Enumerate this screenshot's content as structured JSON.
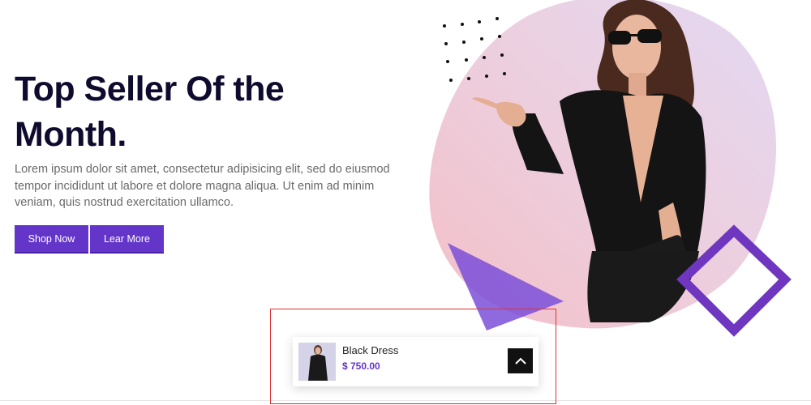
{
  "hero": {
    "title": "Top Seller Of the Month.",
    "description": "Lorem ipsum dolor sit amet, consectetur adipisicing elit, sed do eiusmod tempor incididunt ut labore et dolore magna aliqua. Ut enim ad minim veniam, quis nostrud exercitation ullamco.",
    "buttons": {
      "shop_now": "Shop Now",
      "learn_more": "Lear More"
    }
  },
  "product_card": {
    "name": "Black Dress",
    "price": "$ 750.00",
    "scroll_top_icon": "chevron-up-icon"
  },
  "colors": {
    "accent": "#6435c9",
    "heading": "#0f0b2e",
    "body_text": "#6a6a6a",
    "blob_pink": "#f0c3cf",
    "blob_lavender": "#e4d7ef",
    "triangle": "#7b4fd8",
    "diamond_outline": "#6f37c0",
    "highlight": "#e03131"
  }
}
